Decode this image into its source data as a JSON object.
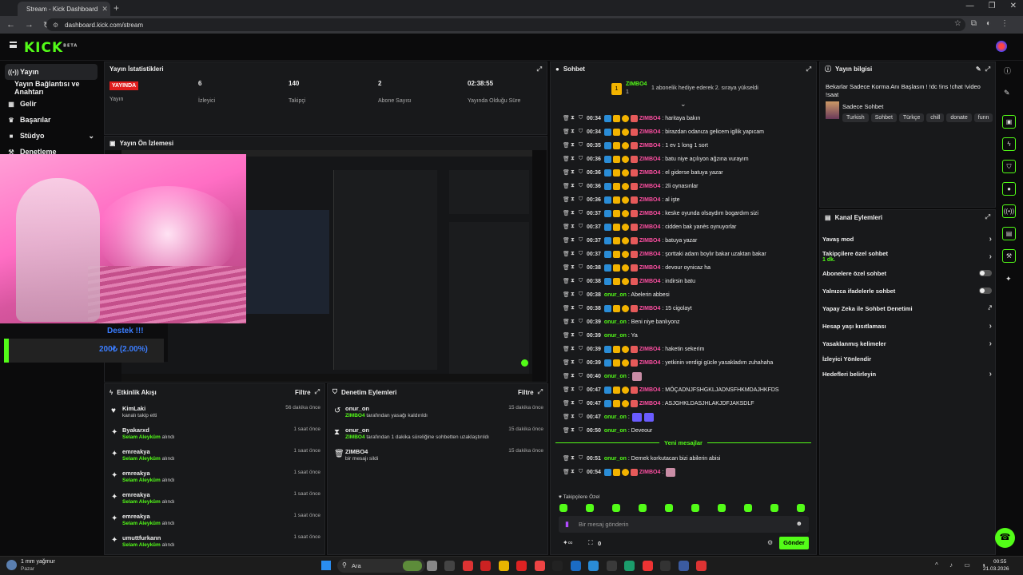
{
  "browser": {
    "tab_title": "Stream - Kick Dashboard",
    "url": "dashboard.kick.com/stream",
    "tab_close": "✕",
    "new_tab": "+"
  },
  "header": {
    "logo": "KICK",
    "logo_sup": "BETA"
  },
  "sidebar": {
    "items": [
      {
        "icon": "((•))",
        "label": "Yayın"
      },
      {
        "icon": "",
        "label": "Yayın Bağlantısı ve Anahtarı"
      },
      {
        "icon": "▦",
        "label": "Gelir"
      },
      {
        "icon": "🏆",
        "label": "Başarılar"
      },
      {
        "icon": "🎥",
        "label": "Stüdyo"
      },
      {
        "icon": "🔧",
        "label": "Denetleme"
      }
    ]
  },
  "stats": {
    "title": "Yayın İstatistikleri",
    "items": [
      {
        "value": "YAYINDA",
        "label": "Yayın"
      },
      {
        "value": "6",
        "label": "İzleyici"
      },
      {
        "value": "140",
        "label": "Takipçi"
      },
      {
        "value": "2",
        "label": "Abone Sayısı"
      },
      {
        "value": "02:38:55",
        "label": "Yayında Olduğu Süre"
      }
    ]
  },
  "preview": {
    "title": "Yayın Ön İzlemesi"
  },
  "donation": {
    "title": "Destek !!!",
    "value": "200₺ (2.00%)",
    "progress_pct": 2
  },
  "activity": {
    "title": "Etkinlik Akışı",
    "filter": "Filtre",
    "items": [
      {
        "icon": "♥",
        "name": "KimLaki",
        "desc": "kanalı takip etti",
        "highlight": "",
        "time": "56 dakika önce"
      },
      {
        "icon": "✦",
        "name": "Byakarxd",
        "desc": "alındı",
        "highlight": "Selam Aleyküm",
        "time": "1 saat önce"
      },
      {
        "icon": "✦",
        "name": "emreakya",
        "desc": "alındı",
        "highlight": "Selam Aleyküm",
        "time": "1 saat önce"
      },
      {
        "icon": "✦",
        "name": "emreakya",
        "desc": "alındı",
        "highlight": "Selam Aleyküm",
        "time": "1 saat önce"
      },
      {
        "icon": "✦",
        "name": "emreakya",
        "desc": "alındı",
        "highlight": "Selam Aleyküm",
        "time": "1 saat önce"
      },
      {
        "icon": "✦",
        "name": "emreakya",
        "desc": "alındı",
        "highlight": "Selam Aleyküm",
        "time": "1 saat önce"
      },
      {
        "icon": "✦",
        "name": "umuttfurkann",
        "desc": "alındı",
        "highlight": "Selam Aleyküm",
        "time": "1 saat önce"
      }
    ]
  },
  "moderation": {
    "title": "Denetim Eylemleri",
    "filter": "Filtre",
    "items": [
      {
        "icon": "↺",
        "name": "onur_on",
        "highlight": "ZIMBO4",
        "desc": "tarafından yasağı kaldırıldı",
        "time": "15 dakika önce"
      },
      {
        "icon": "⧗",
        "name": "onur_on",
        "highlight": "ZIMBO4",
        "desc": "tarafından 1 dakika süreliğine sohbetten uzaklaştırıldı",
        "time": "15 dakika önce"
      },
      {
        "icon": "🗑",
        "name": "ZIMBO4",
        "highlight": "",
        "desc": "bir mesajı sildi",
        "time": "15 dakika önce"
      }
    ]
  },
  "chat": {
    "title": "Sohbet",
    "pinned_user": "ZIMBO4",
    "pinned_count": "1",
    "pinned_rank": "1",
    "pinned_msg": "1 abonelik hediye ederek 2. sıraya yükseldi",
    "messages": [
      {
        "time": "00:34",
        "user": "ZIMBO4",
        "text": ": haritaya bakın",
        "mod": true
      },
      {
        "time": "00:34",
        "user": "ZIMBO4",
        "text": ": birazdan odanıza gelicem igllik yapıcam",
        "mod": true
      },
      {
        "time": "00:35",
        "user": "ZIMBO4",
        "text": ": 1 ev 1 long 1 sort",
        "mod": true
      },
      {
        "time": "00:36",
        "user": "ZIMBO4",
        "text": ": batu niye açılıyon ağzına vurayım",
        "mod": true
      },
      {
        "time": "00:36",
        "user": "ZIMBO4",
        "text": ": el giderse batuya yazar",
        "mod": true
      },
      {
        "time": "00:36",
        "user": "ZIMBO4",
        "text": ": 2li oynasınlar",
        "mod": true
      },
      {
        "time": "00:36",
        "user": "ZIMBO4",
        "text": ": al işte",
        "mod": true
      },
      {
        "time": "00:37",
        "user": "ZIMBO4",
        "text": ": keske oyunda olsaydım bogardım sizi",
        "mod": true
      },
      {
        "time": "00:37",
        "user": "ZIMBO4",
        "text": ": cidden bak yanès oynuyorlar",
        "mod": true
      },
      {
        "time": "00:37",
        "user": "ZIMBO4",
        "text": ": batuya yazar",
        "mod": true
      },
      {
        "time": "00:37",
        "user": "ZIMBO4",
        "text": ": şorttaki adam boylır bakar uzaktan bakar",
        "mod": true
      },
      {
        "time": "00:38",
        "user": "ZIMBO4",
        "text": ": devour oynicaz ha",
        "mod": true
      },
      {
        "time": "00:38",
        "user": "ZIMBO4",
        "text": ": indirsin batu",
        "mod": true
      },
      {
        "time": "00:38",
        "user": "onur_on",
        "text": ": Abelerin abbesi",
        "mod": false
      },
      {
        "time": "00:38",
        "user": "ZIMBO4",
        "text": ": 15 cigolayt",
        "mod": true
      },
      {
        "time": "00:39",
        "user": "onur_on",
        "text": ": Beni niye banlıyonz",
        "mod": false
      },
      {
        "time": "00:39",
        "user": "onur_on",
        "text": ": Ya",
        "mod": false
      },
      {
        "time": "00:39",
        "user": "ZIMBO4",
        "text": ": haketin sekerim",
        "mod": true
      },
      {
        "time": "00:39",
        "user": "ZIMBO4",
        "text": ": yetkinin verdigi gücle yasakladım zuhahaha",
        "mod": true
      },
      {
        "time": "00:40",
        "user": "onur_on",
        "text": ":",
        "mod": false,
        "emote": "p"
      },
      {
        "time": "00:47",
        "user": "ZIMBO4",
        "text": ": MÖÇADNJFSHGKLJADNSFHKMDAJHKFDS",
        "mod": true
      },
      {
        "time": "00:47",
        "user": "ZIMBO4",
        "text": ": ASJGHKLDASJHLAKJDFJAKSDLF",
        "mod": true
      },
      {
        "time": "00:47",
        "user": "onur_on",
        "text": ":",
        "mod": false,
        "emote": "b2"
      },
      {
        "time": "00:50",
        "user": "onur_on",
        "text": ": Deveour",
        "mod": false
      },
      {
        "time": "00:51",
        "user": "onur_on",
        "text": ": Demek korkutacan bizi abilerin abisi",
        "mod": false
      },
      {
        "time": "00:54",
        "user": "ZIMBO4",
        "text": ":",
        "mod": true,
        "emote": "p"
      }
    ],
    "new_messages": "Yeni mesajlar",
    "followers_only": "Takipçilere Özel",
    "placeholder": "Bir mesaj gönderin",
    "points": "0",
    "send": "Gönder",
    "emote_bar_count": 10
  },
  "stream_info": {
    "title": "Yayın bilgisi",
    "stream_title": "Bekarlar Sadece Korma Anı Başlasın ! !dc !ins !chat !video !saat",
    "category": "Sadece Sohbet",
    "tags": [
      "Turkish",
      "Sohbet",
      "Türkçe",
      "chill",
      "donate",
      "funn"
    ]
  },
  "channel_actions": {
    "title": "Kanal Eylemleri",
    "items": [
      {
        "label": "Yavaş mod",
        "sub": "",
        "control": "chevron"
      },
      {
        "label": "Takipçilere özel sohbet",
        "sub": "1 dk.",
        "control": "chevron"
      },
      {
        "label": "Abonelere özel sohbet",
        "sub": "",
        "control": "toggle"
      },
      {
        "label": "Yalnızca ifadelerle sohbet",
        "sub": "",
        "control": "toggle"
      },
      {
        "label": "Yapay Zeka ile Sohbet Denetimi",
        "sub": "",
        "control": "external"
      },
      {
        "label": "Hesap yaşı kısıtlaması",
        "sub": "",
        "control": "chevron"
      },
      {
        "label": "Yasaklanmış kelimeler",
        "sub": "",
        "control": "chevron"
      },
      {
        "label": "İzleyici Yönlendir",
        "sub": "",
        "control": "none"
      },
      {
        "label": "Hedefleri belirleyin",
        "sub": "",
        "control": "chevron"
      }
    ]
  },
  "taskbar": {
    "weather": "1 mm yağmur",
    "weather_sub": "Pazar",
    "search": "Ara",
    "time": "00:55",
    "date": "21.03.2026"
  },
  "colors": {
    "accent": "#53fc18",
    "mod_user": "#ff4fa3",
    "live": "#e21d1d",
    "donation": "#3b7dff"
  }
}
